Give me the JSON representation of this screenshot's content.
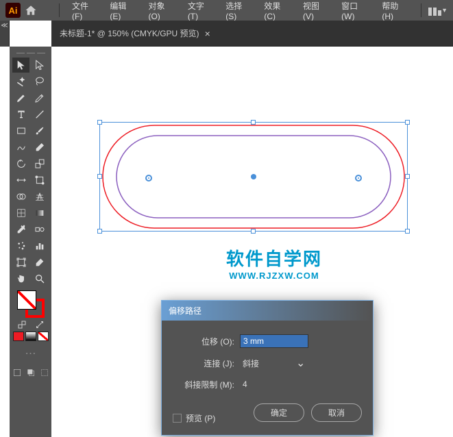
{
  "app": {
    "logo": "Ai"
  },
  "menu": {
    "file": "文件(F)",
    "edit": "编辑(E)",
    "object": "对象(O)",
    "type": "文字(T)",
    "select": "选择(S)",
    "effect": "效果(C)",
    "view": "视图(V)",
    "window": "窗口(W)",
    "help": "帮助(H)"
  },
  "tab": {
    "title": "未标题-1* @ 150% (CMYK/GPU 预览)",
    "close": "×"
  },
  "watermark": {
    "title": "软件自学网",
    "url": "WWW.RJZXW.COM"
  },
  "dialog": {
    "title": "偏移路径",
    "offset_label": "位移 (O):",
    "offset_value": "3 mm",
    "join_label": "连接 (J):",
    "join_value": "斜接",
    "miter_label": "斜接限制 (M):",
    "miter_value": "4",
    "preview_label": "预览 (P)",
    "ok": "确定",
    "cancel": "取消"
  },
  "colors": {
    "stroke": "#ff0000",
    "outer_shape": "#ed1c24",
    "inner_shape": "#8b5fbf",
    "selection": "#4a90d9"
  }
}
